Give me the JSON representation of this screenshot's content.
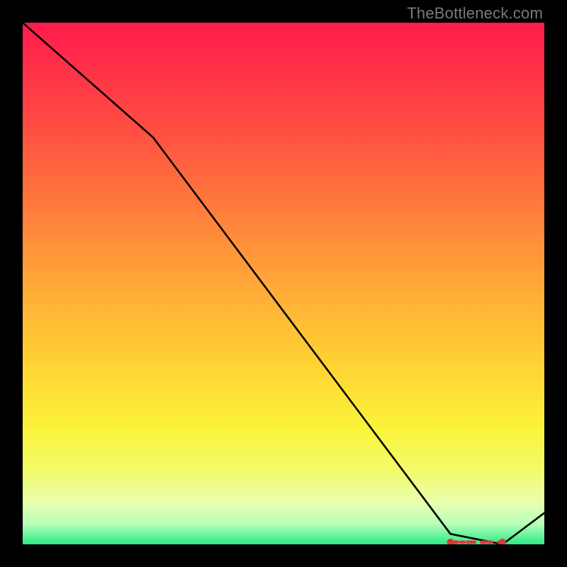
{
  "attribution": "TheBottleneck.com",
  "chart_data": {
    "type": "line",
    "title": "",
    "xlabel": "",
    "ylabel": "",
    "x": [
      0.0,
      0.25,
      0.82,
      0.92,
      1.0
    ],
    "y": [
      1.0,
      0.78,
      0.02,
      0.0,
      0.06
    ],
    "xlim": [
      0,
      1
    ],
    "ylim": [
      0,
      1
    ],
    "background_gradient": {
      "top": "#ff1a4b",
      "mid_upper": "#ff8f3a",
      "mid_lower": "#faf43a",
      "bottom": "#2eeb87"
    },
    "marker_band": {
      "x_start": 0.82,
      "x_end": 0.92,
      "y": 0.0,
      "color": "#d83a3a"
    }
  }
}
